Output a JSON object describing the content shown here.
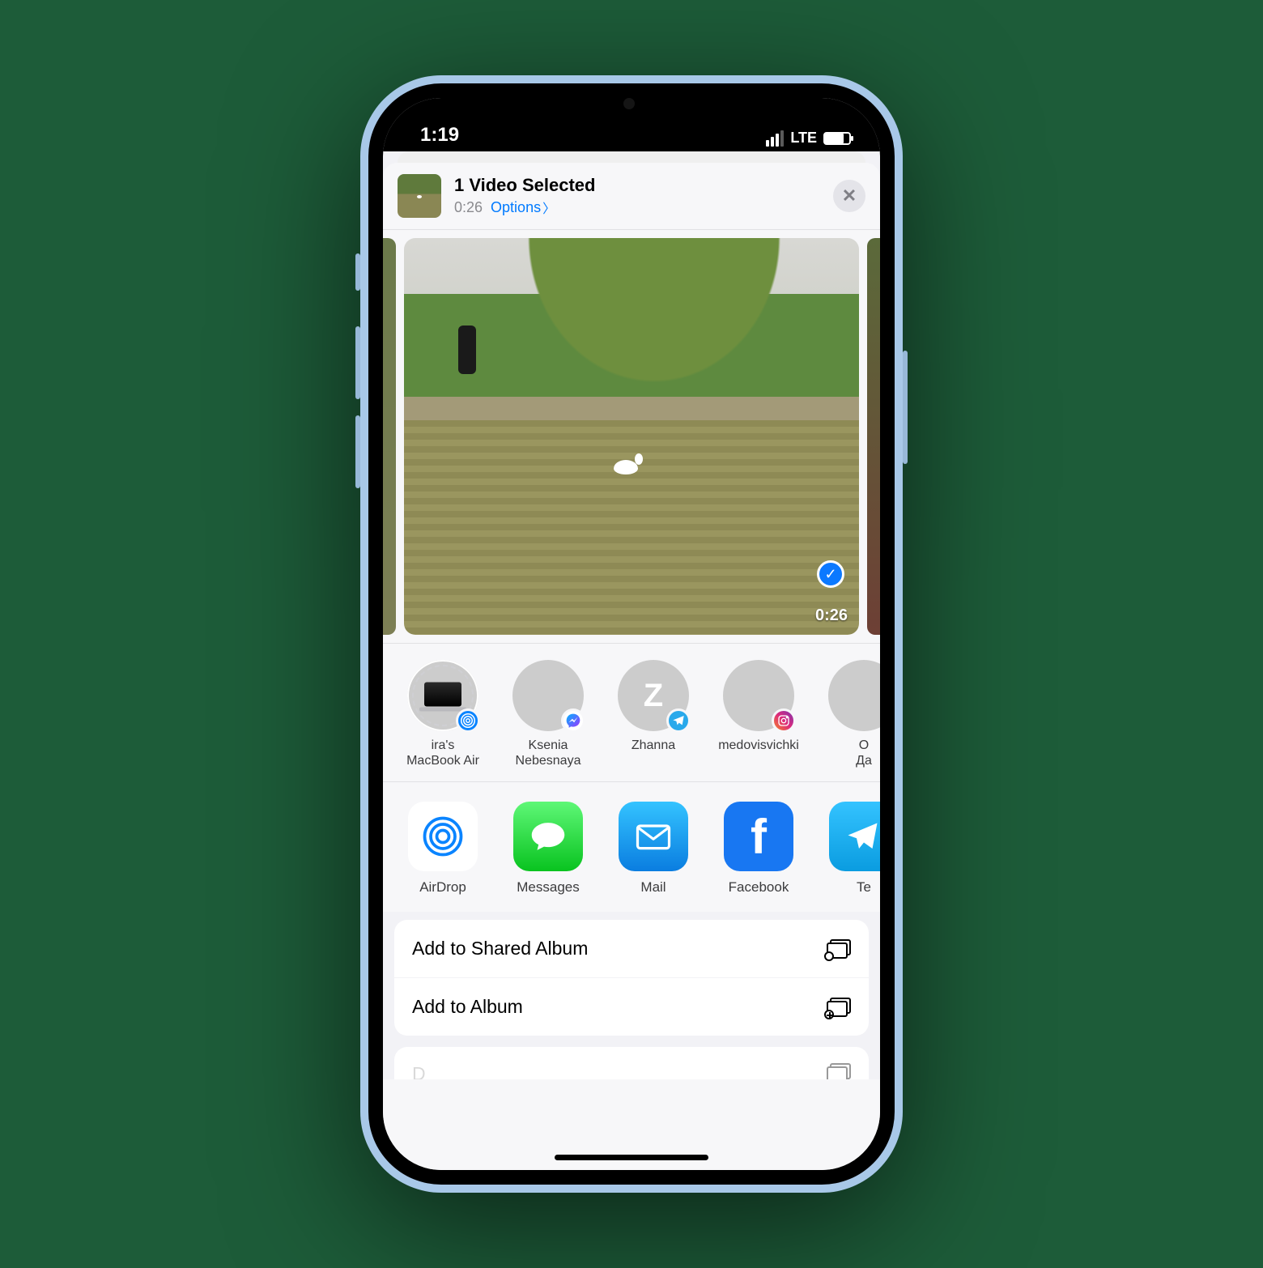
{
  "status_bar": {
    "time": "1:19",
    "network": "LTE"
  },
  "header": {
    "title": "1 Video Selected",
    "duration": "0:26",
    "options_label": "Options"
  },
  "preview": {
    "duration_badge": "0:26"
  },
  "contacts": [
    {
      "name_line1": "ira's",
      "name_line2": "MacBook Air",
      "badge": "airdrop"
    },
    {
      "name_line1": "Ksenia",
      "name_line2": "Nebesnaya",
      "badge": "messenger"
    },
    {
      "name_line1": "Zhanna",
      "name_line2": "",
      "badge": "telegram"
    },
    {
      "name_line1": "medovisvichki",
      "name_line2": "",
      "badge": "instagram"
    },
    {
      "name_line1": "О",
      "name_line2": "Да",
      "badge": ""
    }
  ],
  "apps": [
    {
      "label": "AirDrop"
    },
    {
      "label": "Messages"
    },
    {
      "label": "Mail"
    },
    {
      "label": "Facebook"
    },
    {
      "label": "Te"
    }
  ],
  "actions": [
    {
      "label": "Add to Shared Album"
    },
    {
      "label": "Add to Album"
    }
  ]
}
